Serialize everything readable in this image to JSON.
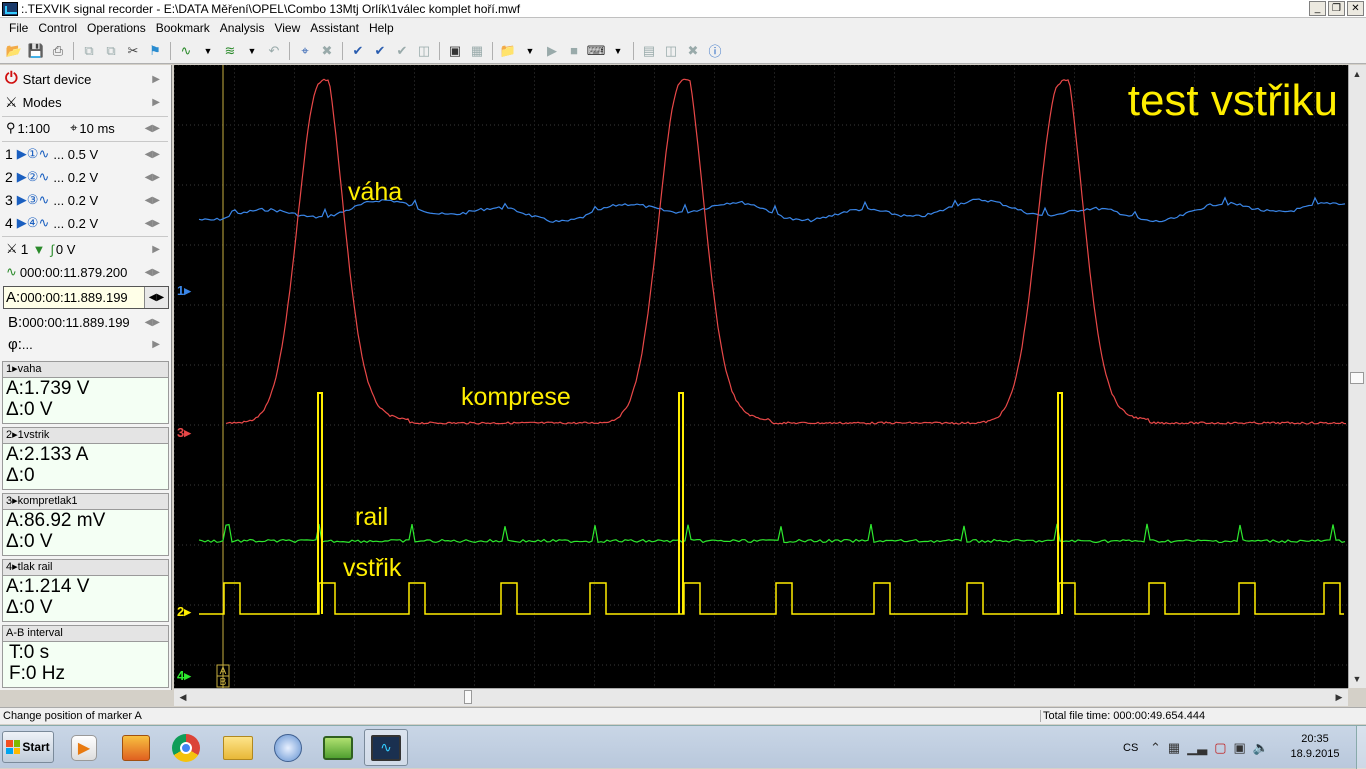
{
  "window": {
    "title": ":.TEXVIK  signal recorder - E:\\DATA Měření\\OPEL\\Combo 13Mtj Orlík\\1válec komplet hoří.mwf",
    "btn_min": "_",
    "btn_max": "❐",
    "btn_close": "✕"
  },
  "menu": [
    "File",
    "Control",
    "Operations",
    "Bookmark",
    "Analysis",
    "View",
    "Assistant",
    "Help"
  ],
  "sidebar": {
    "start_device": "Start device",
    "modes": "Modes",
    "zoom": "1:100",
    "timebase": "10 ms",
    "channels": [
      {
        "num": "1",
        "scale": "... 0.5 V"
      },
      {
        "num": "2",
        "scale": "... 0.2 V"
      },
      {
        "num": "3",
        "scale": "... 0.2 V"
      },
      {
        "num": "4",
        "scale": "... 0.2 V"
      }
    ],
    "trigger_ch": "1",
    "trigger_level": "0 V",
    "trigger_time": "000:00:11.879.200",
    "marker_a": "000:00:11.889.199",
    "marker_b": "000:00:11.889.199",
    "marker_a_label": "A:",
    "marker_b_label": "B:",
    "phi_label": "φ:",
    "phi_value": "...",
    "values": [
      {
        "head": "1▸vaha",
        "a": "A:1.739 V",
        "d": "Δ:0 V"
      },
      {
        "head": "2▸1vstrik",
        "a": "A:2.133 A",
        "d": "Δ:0"
      },
      {
        "head": "3▸kompretlak1",
        "a": "A:86.92 mV",
        "d": "Δ:0 V"
      },
      {
        "head": "4▸tlak rail",
        "a": "A:1.214 V",
        "d": "Δ:0 V"
      }
    ],
    "interval": {
      "head": "A-B interval",
      "t": "T:0 s",
      "f": "F:0 Hz"
    }
  },
  "scope": {
    "title": "test vstřiku",
    "labels": {
      "vaha": "váha",
      "komprese": "komprese",
      "rail": "rail",
      "vstrik": "vstřik"
    },
    "channel_markers": {
      "ch1": "1▸",
      "ch3": "3▸",
      "ch2": "2▸",
      "ch4": "4▸"
    },
    "marker_letters": {
      "a": "A",
      "b": "B"
    },
    "colors": {
      "ch1": "#3a86e8",
      "ch2": "#ffee00",
      "ch3": "#e84848",
      "ch4": "#2ee82e",
      "title": "#ffee00",
      "grid": "#3a3a3a"
    }
  },
  "status": {
    "left": "Change position of marker A",
    "right": "Total file time: 000:00:49.654.444"
  },
  "taskbar": {
    "start": "Start",
    "lang": "CS",
    "time": "20:35",
    "date": "18.9.2015"
  }
}
